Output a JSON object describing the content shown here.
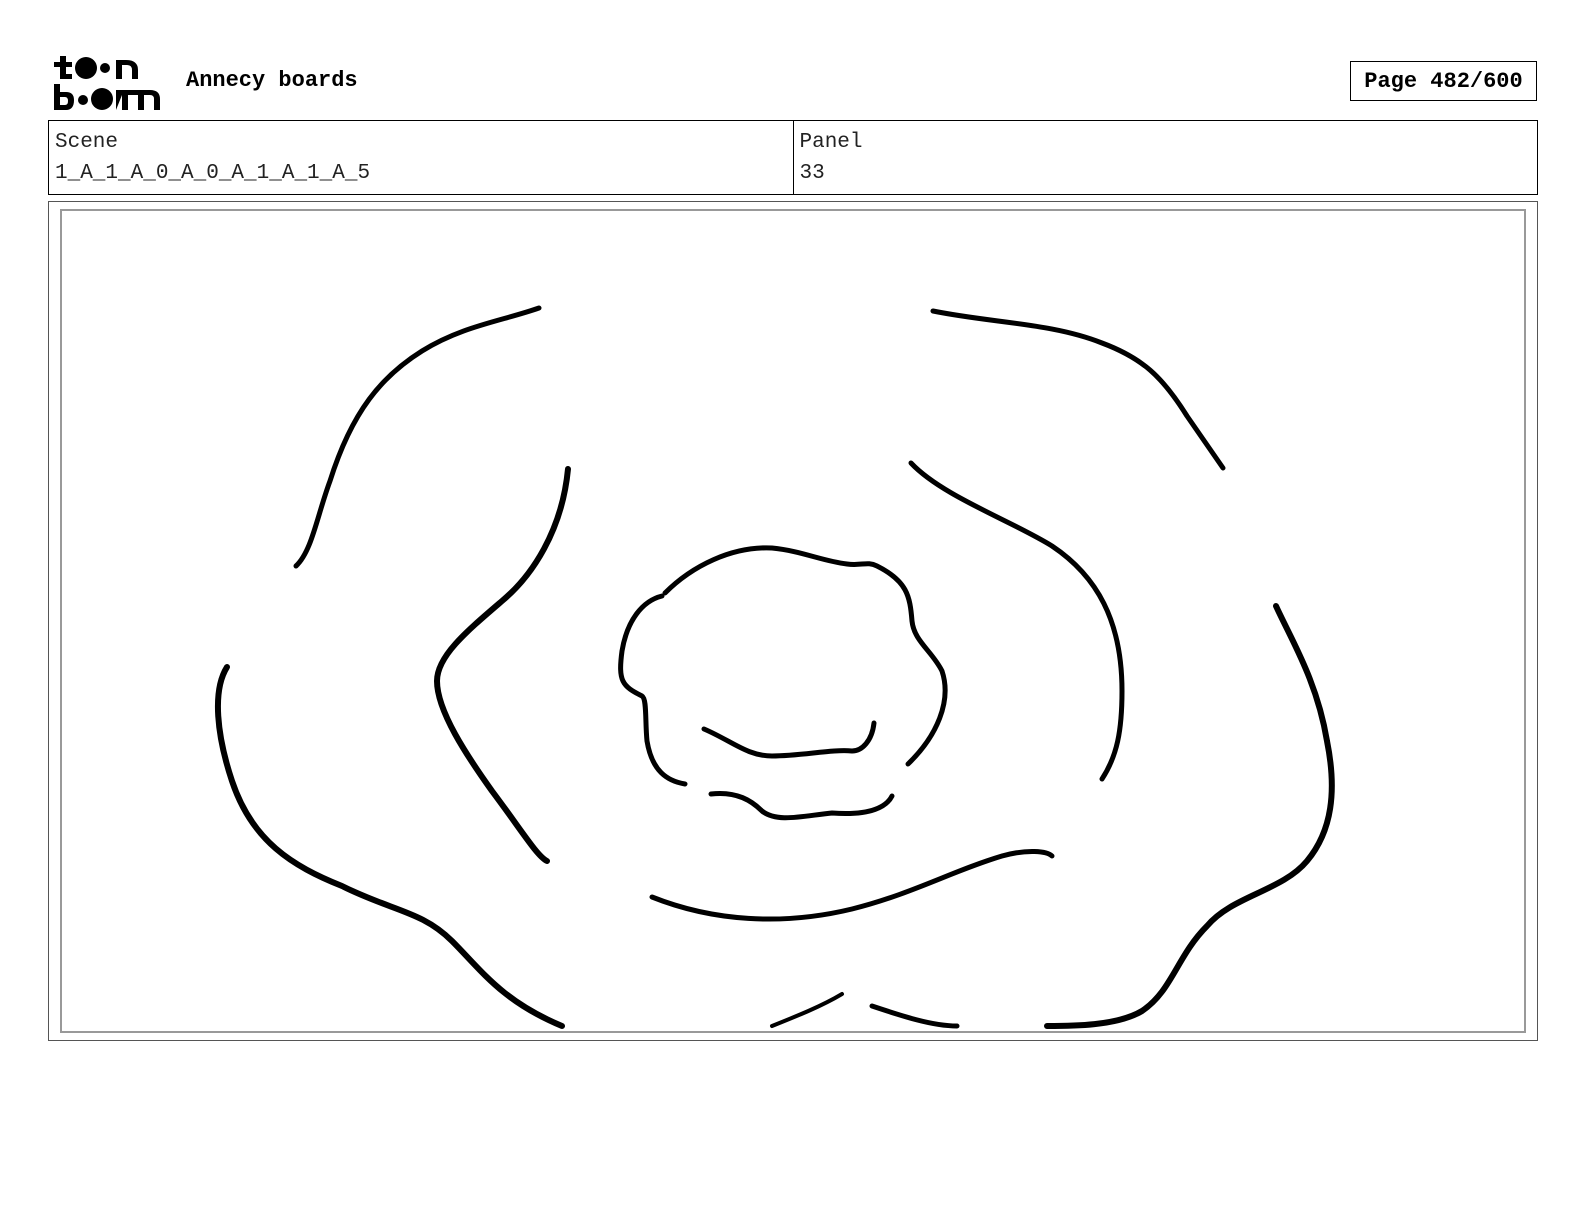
{
  "header": {
    "logo_text": "toon boom",
    "title": "Annecy boards",
    "page_counter": "Page 482/600"
  },
  "info": {
    "scene_label": "Scene",
    "scene_value": "1_A_1_A_0_A_0_A_1_A_1_A_5",
    "panel_label": "Panel",
    "panel_value": "33"
  },
  "panel_image": {
    "description_icon": "rose-sketch"
  }
}
